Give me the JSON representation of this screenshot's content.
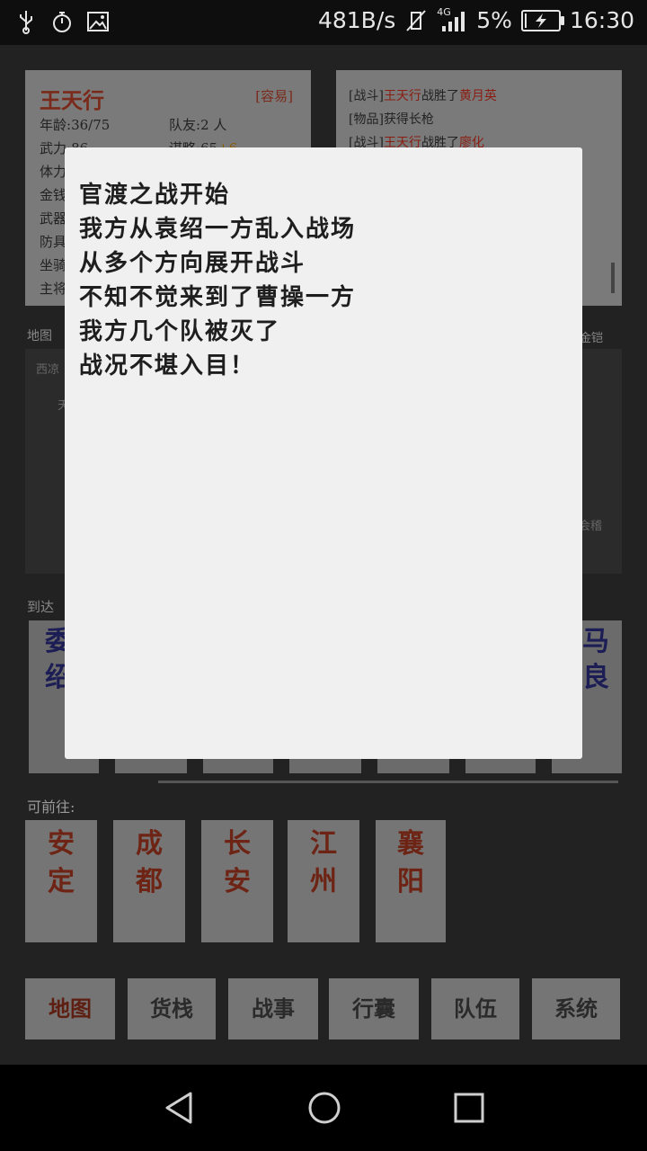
{
  "status_bar": {
    "speed": "481B/s",
    "network": "4G",
    "battery_percent": "5%",
    "battery_level": 0.05,
    "time": "16:30"
  },
  "hero": {
    "name": "王天行",
    "difficulty": "[容易]",
    "age_label": "年龄:",
    "age_value": "36/75",
    "team_label": "队友:",
    "team_value": "2 人",
    "force_label": "武力:",
    "force_value": "86",
    "strategy_label": "谋略:",
    "strategy_value": "65",
    "strategy_bonus": "+6",
    "row_labels": [
      "体力",
      "金钱",
      "武器",
      "防具",
      "坐骑",
      "主将"
    ]
  },
  "log": {
    "lines": [
      {
        "tag": "[战斗]",
        "actor": "王天行",
        "mid": "战胜了",
        "target": "黄月英"
      },
      {
        "tag": "[物品]",
        "actor": "",
        "mid": "获得长枪",
        "target": ""
      },
      {
        "tag": "[战斗]",
        "actor": "王天行",
        "mid": "战胜了",
        "target": "廖化"
      }
    ]
  },
  "map": {
    "label": "地图",
    "right_label": "金铠",
    "places": [
      "西凉",
      "天",
      "会稽"
    ]
  },
  "arrive": {
    "label": "到达",
    "first_card": [
      "委",
      "绍"
    ],
    "last_card": [
      "马",
      "良"
    ]
  },
  "destinations": {
    "label": "可前往:",
    "items": [
      {
        "line1": "安",
        "line2": "定"
      },
      {
        "line1": "成",
        "line2": "都"
      },
      {
        "line1": "长",
        "line2": "安"
      },
      {
        "line1": "江",
        "line2": "州"
      },
      {
        "line1": "襄",
        "line2": "阳"
      }
    ]
  },
  "menu": {
    "items": [
      "地图",
      "货栈",
      "战事",
      "行囊",
      "队伍",
      "系统"
    ]
  },
  "dialog": {
    "lines": [
      "官渡之战开始",
      "我方从袁绍一方乱入战场",
      "从多个方向展开战斗",
      "不知不觉来到了曹操一方",
      "我方几个队被灭了",
      "战况不堪入目！"
    ]
  }
}
